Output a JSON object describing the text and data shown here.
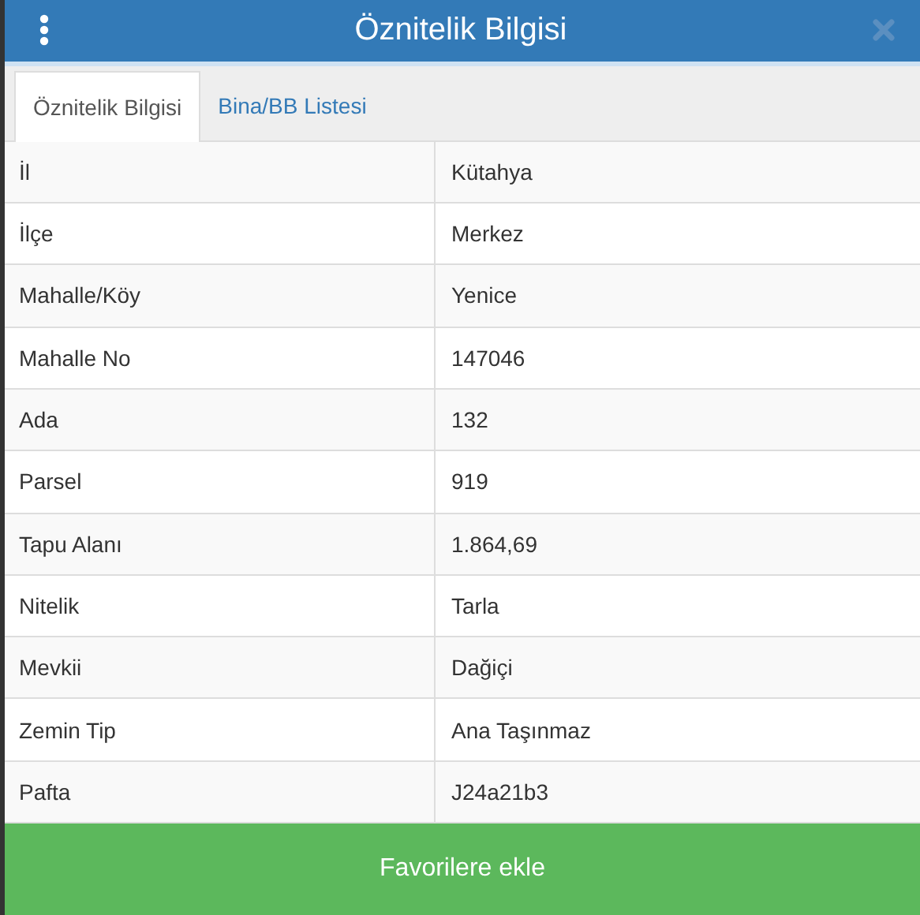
{
  "window": {
    "title": "Öznitelik Bilgisi"
  },
  "tabs": [
    {
      "label": "Öznitelik Bilgisi",
      "selected": true
    },
    {
      "label": "Bina/BB Listesi",
      "selected": false
    }
  ],
  "table": {
    "rows": [
      {
        "label": "İl",
        "value": "Kütahya"
      },
      {
        "label": "İlçe",
        "value": "Merkez"
      },
      {
        "label": "Mahalle/Köy",
        "value": "Yenice"
      },
      {
        "label": "Mahalle No",
        "value": "147046"
      },
      {
        "label": "Ada",
        "value": "132"
      },
      {
        "label": "Parsel",
        "value": "919"
      },
      {
        "label": "Tapu Alanı",
        "value": "1.864,69"
      },
      {
        "label": "Nitelik",
        "value": "Tarla"
      },
      {
        "label": "Mevkii",
        "value": "Dağiçi"
      },
      {
        "label": "Zemin Tip",
        "value": "Ana Taşınmaz"
      },
      {
        "label": "Pafta",
        "value": "J24a21b3"
      }
    ]
  },
  "buttons": [
    {
      "label": "Favorilere ekle"
    }
  ]
}
